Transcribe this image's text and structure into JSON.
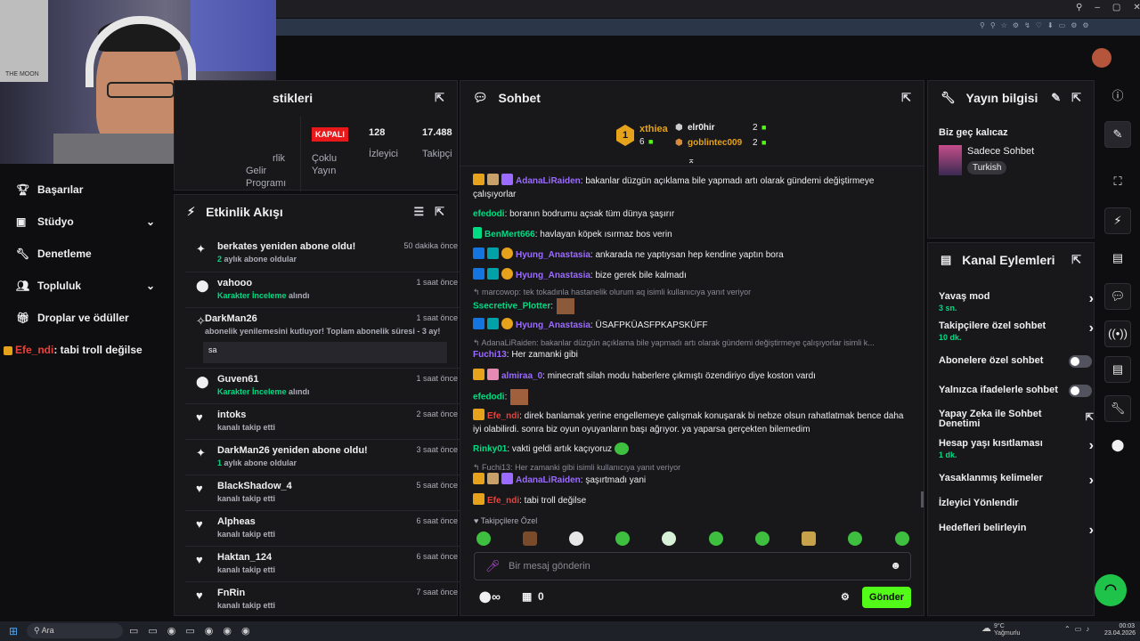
{
  "browser": {
    "toolbar_icons": [
      "search-icon",
      "minimize-icon",
      "restore-icon",
      "close-icon"
    ]
  },
  "webcam": {
    "poster_text": "THE MOON"
  },
  "stats_panel": {
    "title": "stikleri",
    "cols": [
      {
        "label_line1": "rlik",
        "label_line2": "Gelir",
        "label_line3": "Programı"
      },
      {
        "badge": "KAPALI",
        "label_line1": "Çoklu",
        "label_line2": "Yayın"
      },
      {
        "value": "128",
        "label": "İzleyici"
      },
      {
        "value": "17.488",
        "label": "Takipçi"
      }
    ]
  },
  "left_nav": {
    "items": [
      {
        "label": "Başarılar"
      },
      {
        "label": "Stüdyo"
      },
      {
        "label": "Denetleme"
      },
      {
        "label": "Topluluk"
      },
      {
        "label": "Droplar ve ödüller"
      }
    ],
    "chat_preview_user": "Efe_ndi",
    "chat_preview_text": ": tabi troll değilse"
  },
  "activity": {
    "title": "Etkinlik Akışı",
    "items": [
      {
        "name": "berkates yeniden abone oldu!",
        "sub_num": "2",
        "sub": " aylık abone oldular",
        "time": "50 dakika önce"
      },
      {
        "name": "vahooo",
        "sub_green": "Karakter İnceleme",
        "sub": " alındı",
        "time": "1 saat önce"
      },
      {
        "name": "DarkMan26",
        "sub": "abonelik yenilemesini kutluyor! Toplam abonelik süresi - 3 ay!",
        "reply": "sa",
        "time": "1 saat önce"
      },
      {
        "name": "Guven61",
        "sub_green": "Karakter İnceleme",
        "sub": " alındı",
        "time": "1 saat önce"
      },
      {
        "name": "intoks",
        "sub": "kanalı takip etti",
        "time": "2 saat önce"
      },
      {
        "name": "DarkMan26 yeniden abone oldu!",
        "sub_num": "1",
        "sub": " aylık abone oldular",
        "time": "3 saat önce"
      },
      {
        "name": "BlackShadow_4",
        "sub": "kanalı takip etti",
        "time": "5 saat önce"
      },
      {
        "name": "Alpheas",
        "sub": "kanalı takip etti",
        "time": "6 saat önce"
      },
      {
        "name": "Haktan_124",
        "sub": "kanalı takip etti",
        "time": "6 saat önce"
      },
      {
        "name": "FnRin",
        "sub": "kanalı takip etti",
        "time": "7 saat önce"
      }
    ]
  },
  "chat": {
    "title": "Sohbet",
    "leaderboard": {
      "top_name": "xthiea",
      "top_rank": "1",
      "top_count": "6",
      "second_name": "elr0hir",
      "second_count": "2",
      "third_name": "goblintec009",
      "third_count": "2"
    },
    "messages": [
      {
        "user": "AdanaLiRaiden",
        "color": "#9b6bff",
        "text": ": bakanlar düzgün açıklama bile yapmadı artı olarak gündemi değiştirmeye çalışıyorlar"
      },
      {
        "user": "efedodi",
        "color": "#00db84",
        "text": ": boranın bodrumu açsak tüm dünya şaşırır"
      },
      {
        "user": "BenMert666",
        "color": "#00db84",
        "text": ": havlayan köpek ısırmaz bos verin"
      },
      {
        "user": "Hyung_Anastasia",
        "color": "#9b6bff",
        "text": ": ankarada ne yaptıysan hep kendine yaptın bora"
      },
      {
        "user": "Hyung_Anastasia",
        "color": "#9b6bff",
        "text": ": bize gerek bile kalmadı"
      },
      {
        "reply": "marcowop: tek tokadınla hastanelik olurum aq isimli kullanıcıya yanıt veriyor"
      },
      {
        "user": "Ssecretive_Plotter",
        "color": "#00db84",
        "text": ":"
      },
      {
        "user": "Hyung_Anastasia",
        "color": "#9b6bff",
        "text": ": ÜSAFPKÜASFPKAPSKÜFF"
      },
      {
        "reply": "AdanaLiRaiden: bakanlar düzgün açıklama bile yapmadı artı olarak gündemi değiştirmeye çalışıyorlar isimli k..."
      },
      {
        "user": "Fuchi13",
        "color": "#9b6bff",
        "text": ": Her zamanki gibi"
      },
      {
        "user": "almiraa_0",
        "color": "#9b6bff",
        "text": ": minecraft silah modu haberlere çıkmıştı özendiriyo diye koston vardı"
      },
      {
        "user": "efedodi",
        "color": "#00db84",
        "text": ":"
      },
      {
        "user": "Efe_ndi",
        "color": "#e9423a",
        "text": ": direk banlamak yerine engellemeye çalışmak konuşarak bi nebze olsun rahatlatmak bence daha iyi olabilirdi. sonra biz oyun oyuyanların başı ağrıyor. ya yaparsa gerçekten bilemedim"
      },
      {
        "user": "Rinky01",
        "color": "#00db84",
        "text": ": vakti geldi artık kaçıyoruz"
      },
      {
        "reply": "Fuchi13: Her zamanki gibi isimli kullanıcıya yanıt veriyor"
      },
      {
        "user": "AdanaLiRaiden",
        "color": "#9b6bff",
        "text": ": şaşırtmadı yani"
      },
      {
        "user": "Efe_ndi",
        "color": "#e9423a",
        "text": ": tabi troll değilse"
      }
    ],
    "emote_section": "Takipçilere Özel",
    "input_placeholder": "Bir mesaj gönderin",
    "infinity": "∞",
    "points": "0",
    "send_label": "Gönder"
  },
  "stream_info": {
    "title": "Yayın bilgisi",
    "stream_title": "Biz geç kalıcaz",
    "category": "Sadece Sohbet",
    "tag": "Turkish"
  },
  "channel_actions": {
    "title": "Kanal Eylemleri",
    "items": [
      {
        "label": "Yavaş mod",
        "sub": "3 sn.",
        "kind": "arrow"
      },
      {
        "label": "Takipçilere özel sohbet",
        "sub": "10 dk.",
        "kind": "arrow"
      },
      {
        "label": "Abonelere özel sohbet",
        "kind": "toggle"
      },
      {
        "label": "Yalnızca ifadelerle sohbet",
        "kind": "toggle"
      },
      {
        "label": "Yapay Zeka ile Sohbet",
        "label2": "Denetimi",
        "kind": "external"
      },
      {
        "label": "Hesap yaşı kısıtlaması",
        "sub": "1 dk.",
        "kind": "arrow"
      },
      {
        "label": "Yasaklanmış kelimeler",
        "kind": "arrow"
      },
      {
        "label": "İzleyici Yönlendir",
        "kind": "none"
      },
      {
        "label": "Hedefleri belirleyin",
        "kind": "arrow"
      }
    ]
  },
  "taskbar": {
    "search": "Ara",
    "weather_temp": "9°C",
    "weather_text": "Yağmurlu",
    "time": "00:03",
    "date": "23.04.2026"
  },
  "colors": {
    "accent": "#53fc18",
    "green": "#00db84",
    "red": "#e9423a",
    "purple": "#9b6bff"
  }
}
